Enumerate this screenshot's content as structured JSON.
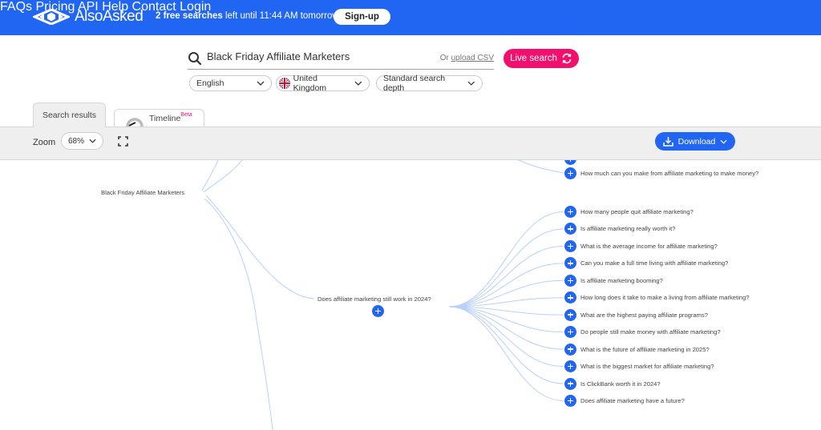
{
  "header": {
    "brand": "AlsoAsked",
    "free_count": "2 free searches",
    "free_rest": " left until 11:44 AM tomorrow",
    "signup_label": "Sign-up",
    "nav": [
      "FAQs",
      "Pricing",
      "API",
      "Help",
      "Contact",
      "Login"
    ]
  },
  "search": {
    "query": "Black Friday Affiliate Marketers",
    "upload_prefix": "Or ",
    "upload_link": "upload CSV",
    "live_search_label": "Live search",
    "language": "English",
    "region": "United Kingdom",
    "depth": "Standard search depth"
  },
  "tabs": {
    "search_results": "Search results",
    "timeline": "Timeline",
    "timeline_badge": "Beta"
  },
  "toolbar": {
    "zoom_label": "Zoom",
    "zoom_value": "68%",
    "download_label": "Download"
  },
  "mindmap": {
    "root": "Black Friday Affiliate Marketers",
    "top_partial_question": "How much can you make from affiliate marketing to make money?",
    "branch": "Does affiliate marketing still work in 2024?",
    "branch_questions": [
      "How many people quit affiliate marketing?",
      "Is affiliate marketing really worth it?",
      "What is the average income for affiliate marketing?",
      "Can you make a full time living with affiliate marketing?",
      "Is affiliate marketing booming?",
      "How long does it take to make a living from affiliate marketing?",
      "What are the highest paying affiliate programs?",
      "Do people still make money with affiliate marketing?",
      "What is the future of affiliate marketing in 2025?",
      "What is the biggest market for affiliate marketing?",
      "Is ClickBank worth it in 2024?",
      "Does affiliate marketing have a future?"
    ]
  },
  "colors": {
    "brand_blue": "#2166f3",
    "live_pink": "#f2106e",
    "line_blue": "#b9d0fb"
  }
}
